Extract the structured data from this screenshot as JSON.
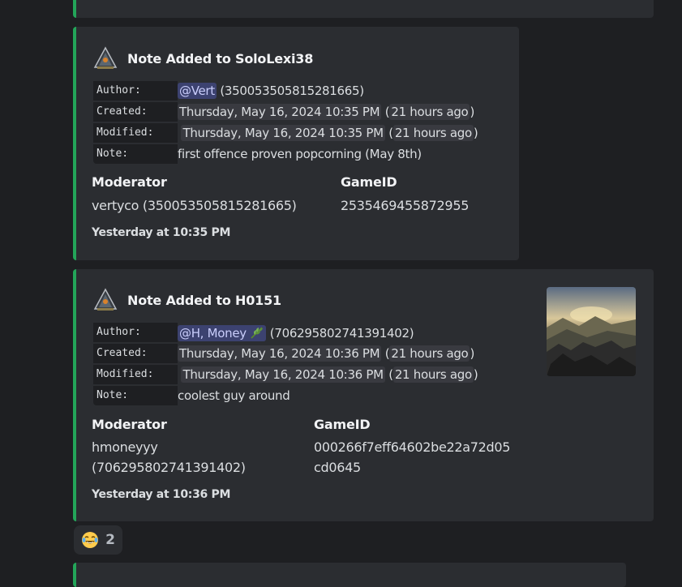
{
  "embeds": [
    {
      "title": "Note Added to SoloLexi38",
      "fields": {
        "author_label": "Author:",
        "author_mention": "@Vert",
        "author_id": "(350053505815281665)",
        "created_label": "Created:",
        "created_ts": "Thursday, May 16, 2024 10:35 PM",
        "created_rel": "21 hours ago",
        "modified_label": "Modified:",
        "modified_ts": "Thursday, May 16, 2024 10:35 PM",
        "modified_rel": "21 hours ago",
        "note_label": "Note:",
        "note_text": "first offence proven popcorning (May 8th)"
      },
      "moderator_label": "Moderator",
      "moderator_value": "vertyco (350053505815281665)",
      "gameid_label": "GameID",
      "gameid_value": "2535469455872955",
      "footer": "Yesterday at 10:35 PM"
    },
    {
      "title": "Note Added to H0151",
      "fields": {
        "author_label": "Author:",
        "author_mention": "@H, Money",
        "author_emoji": "herb-icon",
        "author_id": "(706295802741391402)",
        "created_label": "Created:",
        "created_ts": "Thursday, May 16, 2024 10:36 PM",
        "created_rel": "21 hours ago",
        "modified_label": "Modified:",
        "modified_ts": "Thursday, May 16, 2024 10:36 PM",
        "modified_rel": "21 hours ago",
        "note_label": "Note:",
        "note_text": "coolest guy around"
      },
      "moderator_label": "Moderator",
      "moderator_value_line1": "hmoneyyy",
      "moderator_value_line2": "(706295802741391402)",
      "gameid_label": "GameID",
      "gameid_value_line1": "000266f7eff64602be22a72d05",
      "gameid_value_line2": "cd0645",
      "footer": "Yesterday at 10:36 PM",
      "thumbnail": "mountain-landscape"
    }
  ],
  "reaction": {
    "emoji": "joy-icon",
    "count": "2"
  },
  "colors": {
    "background": "#1e1f22",
    "embed_bg": "#2b2d31",
    "accent": "#23a559",
    "mention_bg": "#3c4270",
    "mention_text": "#c9cdfb"
  }
}
